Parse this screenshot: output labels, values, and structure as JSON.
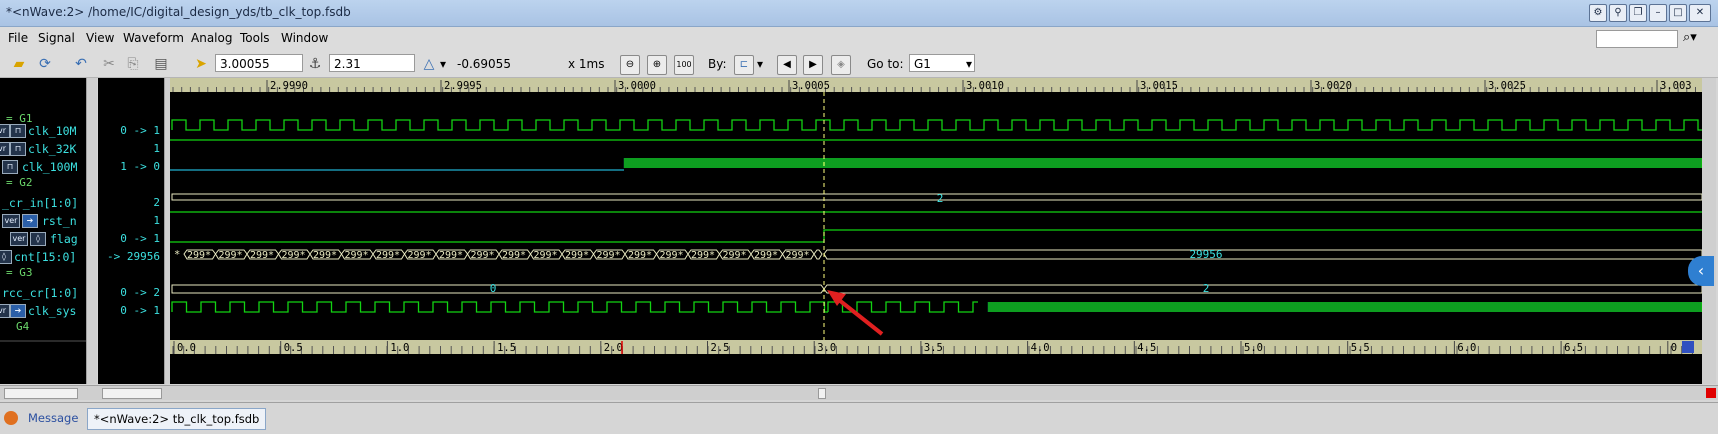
{
  "window": {
    "title": "*<nWave:2> /home/IC/digital_design_yds/tb_clk_top.fsdb"
  },
  "menu": [
    "File",
    "Signal",
    "View",
    "Waveform",
    "Analog",
    "Tools",
    "Window"
  ],
  "toolbar": {
    "cursor_time": "3.00055",
    "marker_time": "2.31",
    "delta": "-0.69055",
    "unit": "x 1ms",
    "by_label": "By:",
    "goto_label": "Go to:",
    "goto_value": "G1"
  },
  "ruler_top": [
    "2.9990",
    "2.9995",
    "3.0000",
    "3.0005",
    "3.0010",
    "3.0015",
    "3.0020",
    "3.0025",
    "3.003"
  ],
  "ruler_bottom": [
    "0.0",
    "0.5",
    "1.0",
    "1.5",
    "2.0",
    "2.5",
    "3.0",
    "3.5",
    "4.0",
    "4.5",
    "5.0",
    "5.5",
    "6.0",
    "6.5",
    "0"
  ],
  "rows": [
    {
      "kind": "group",
      "name": "= G1"
    },
    {
      "kind": "signal",
      "icon": "clock",
      "name": "clk_10M",
      "value": "0 -> 1"
    },
    {
      "kind": "signal",
      "icon": "clock",
      "name": "clk_32K",
      "value": "1"
    },
    {
      "kind": "signal",
      "icon": "clock",
      "name": "clk_100M",
      "value": "1 -> 0"
    },
    {
      "kind": "group",
      "name": "= G2"
    },
    {
      "kind": "signal",
      "icon": "none",
      "name": "_cr_in[1:0]",
      "value": "2"
    },
    {
      "kind": "signal",
      "icon": "verilog",
      "name": "rst_n",
      "value": "1"
    },
    {
      "kind": "signal",
      "icon": "verilog",
      "name": "flag",
      "value": "0 -> 1"
    },
    {
      "kind": "signal",
      "icon": "none",
      "name": "cnt[15:0]",
      "value": "-> 29956"
    },
    {
      "kind": "group",
      "name": "= G3"
    },
    {
      "kind": "signal",
      "icon": "none",
      "name": "rcc_cr[1:0]",
      "value": "0 -> 2"
    },
    {
      "kind": "signal",
      "icon": "verilog",
      "name": "clk_sys",
      "value": "0 -> 1"
    },
    {
      "kind": "group",
      "name": "G4"
    }
  ],
  "bus_labels": {
    "cr_in": "2",
    "cnt_before": "299*",
    "cnt_after": "29956",
    "cnt_first": "*",
    "rcc_before": "0",
    "rcc_after": "2"
  },
  "status": {
    "message_tab": "Message",
    "wave_tab": "*<nWave:2> tb_clk_top.fsdb"
  },
  "colors": {
    "wave_bg": "#000000",
    "clock_green": "#12d312",
    "bus_yellow": "#e8e8c0",
    "cyan_text": "#3ce0e0",
    "cursor": "#ffff80",
    "arrow": "#e02020"
  }
}
